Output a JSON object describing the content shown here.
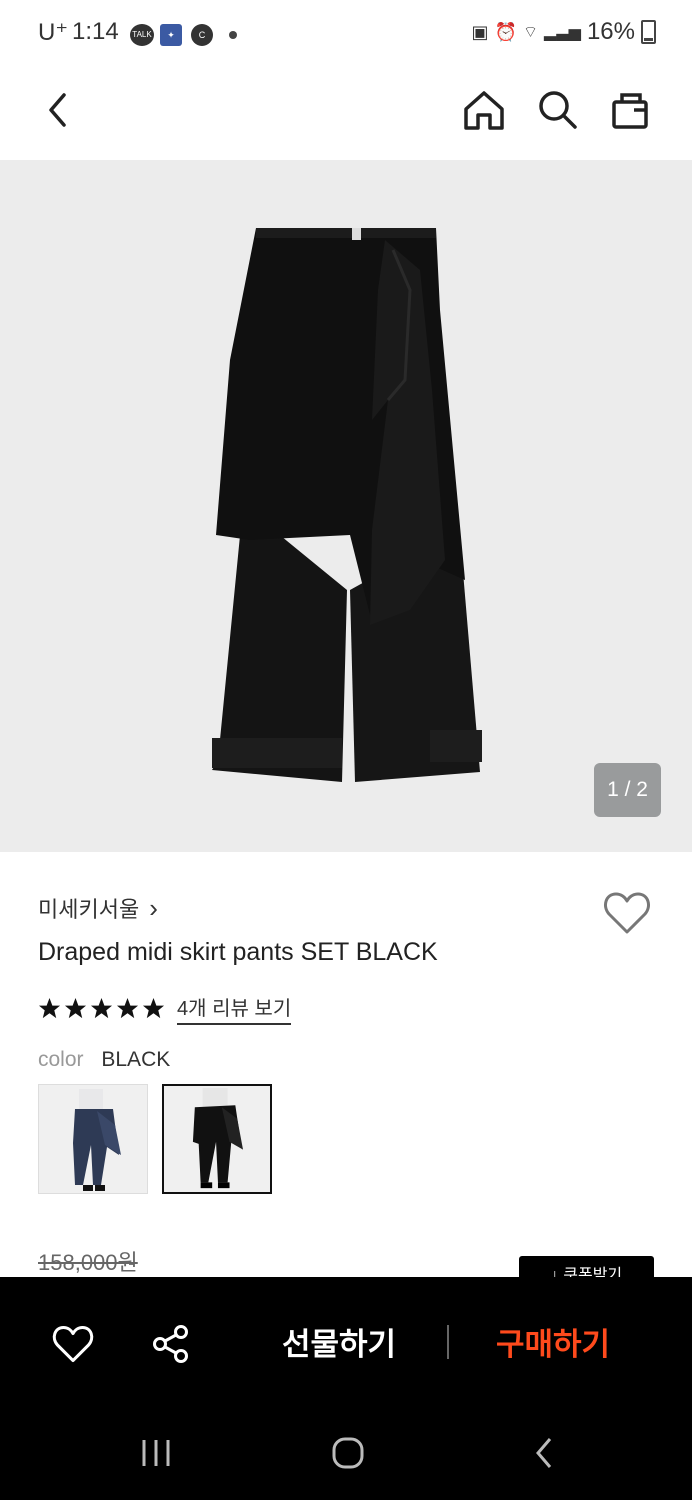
{
  "status": {
    "carrier": "U⁺",
    "time": "1:14",
    "notif_talk": "TALK",
    "notif_c": "C",
    "battery": "16%"
  },
  "header": {
    "back_icon": "chevron-left-icon",
    "home_icon": "home-icon",
    "search_icon": "search-icon",
    "bag_icon": "shopping-bag-icon"
  },
  "hero": {
    "counter": "1 / 2"
  },
  "product": {
    "brand": "미세키서울",
    "brand_arrow": "›",
    "title": "Draped midi skirt pants SET BLACK",
    "rating_stars": 5,
    "review_link": "4개 리뷰 보기",
    "color_label": "color",
    "color_value": "BLACK",
    "original_price": "158,000원",
    "coupon_label": "↓ 쿠폰받기"
  },
  "bottom": {
    "gift_label": "선물하기",
    "buy_label": "구매하기",
    "buy_color": "#ff4a1c"
  }
}
